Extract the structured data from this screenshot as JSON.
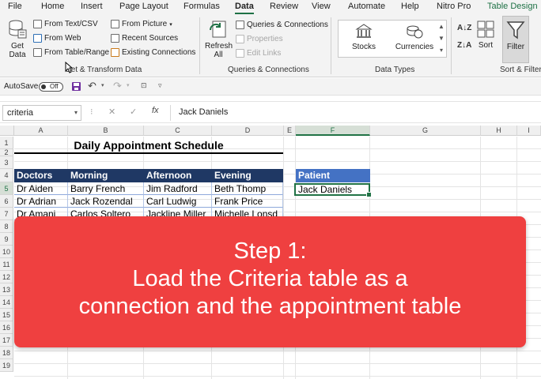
{
  "menu": {
    "tabs": [
      "File",
      "Home",
      "Insert",
      "Page Layout",
      "Formulas",
      "Data",
      "Review",
      "View",
      "Automate",
      "Help",
      "Nitro Pro",
      "Table Design"
    ],
    "active": "Data"
  },
  "ribbon": {
    "get_data": {
      "line1": "Get",
      "line2": "Data"
    },
    "get_transform": {
      "items": [
        "From Text/CSV",
        "From Web",
        "From Table/Range",
        "From Picture",
        "Recent Sources",
        "Existing Connections"
      ],
      "label": "Get & Transform Data"
    },
    "queries": {
      "refresh_line1": "Refresh",
      "refresh_line2": "All",
      "items": [
        "Queries & Connections",
        "Properties",
        "Edit Links"
      ],
      "label": "Queries & Connections"
    },
    "data_types": {
      "items": [
        "Stocks",
        "Currencies"
      ],
      "label": "Data Types"
    },
    "sort_filter": {
      "az": "A↓Z",
      "za": "Z↓A",
      "sort": "Sort",
      "filter": "Filter",
      "label": "Sort & Filter"
    }
  },
  "qat": {
    "autosave_label": "AutoSave",
    "autosave_state": "Off"
  },
  "formula_bar": {
    "name_box": "criteria",
    "cancel": "✕",
    "enter": "✓",
    "fx": "fx",
    "value": "Jack Daniels"
  },
  "columns": [
    "A",
    "B",
    "C",
    "D",
    "E",
    "F",
    "G",
    "H",
    "I"
  ],
  "selected_column": "F",
  "rows": [
    "1",
    "2",
    "3",
    "4",
    "5",
    "6",
    "7",
    "8",
    "9",
    "10",
    "11",
    "12",
    "13",
    "14",
    "15",
    "16",
    "17",
    "18",
    "19"
  ],
  "selected_row": "5",
  "sheet": {
    "title": "Daily Appointment  Schedule",
    "headers": [
      "Doctors",
      "Morning",
      "Afternoon",
      "Evening"
    ],
    "rows": [
      [
        "Dr Aiden",
        "Barry French",
        "Jim Radford",
        "Beth Thomp"
      ],
      [
        "Dr Adrian",
        "Jack Rozendal",
        "Carl Ludwig",
        "Frank Price"
      ],
      [
        "Dr Amani",
        "Carlos Soltero",
        "Jackline Miller",
        "Michelle Lonsd"
      ]
    ],
    "criteria_header": "Patient",
    "criteria_value": "Jack Daniels"
  },
  "overlay": {
    "lines": [
      "Step 1:",
      "Load the Criteria table as a",
      "connection and the appointment table"
    ]
  },
  "colors": {
    "excel_green": "#217346",
    "table_header": "#1f3864",
    "criteria_header": "#4472c4",
    "overlay": "#ef4040"
  }
}
